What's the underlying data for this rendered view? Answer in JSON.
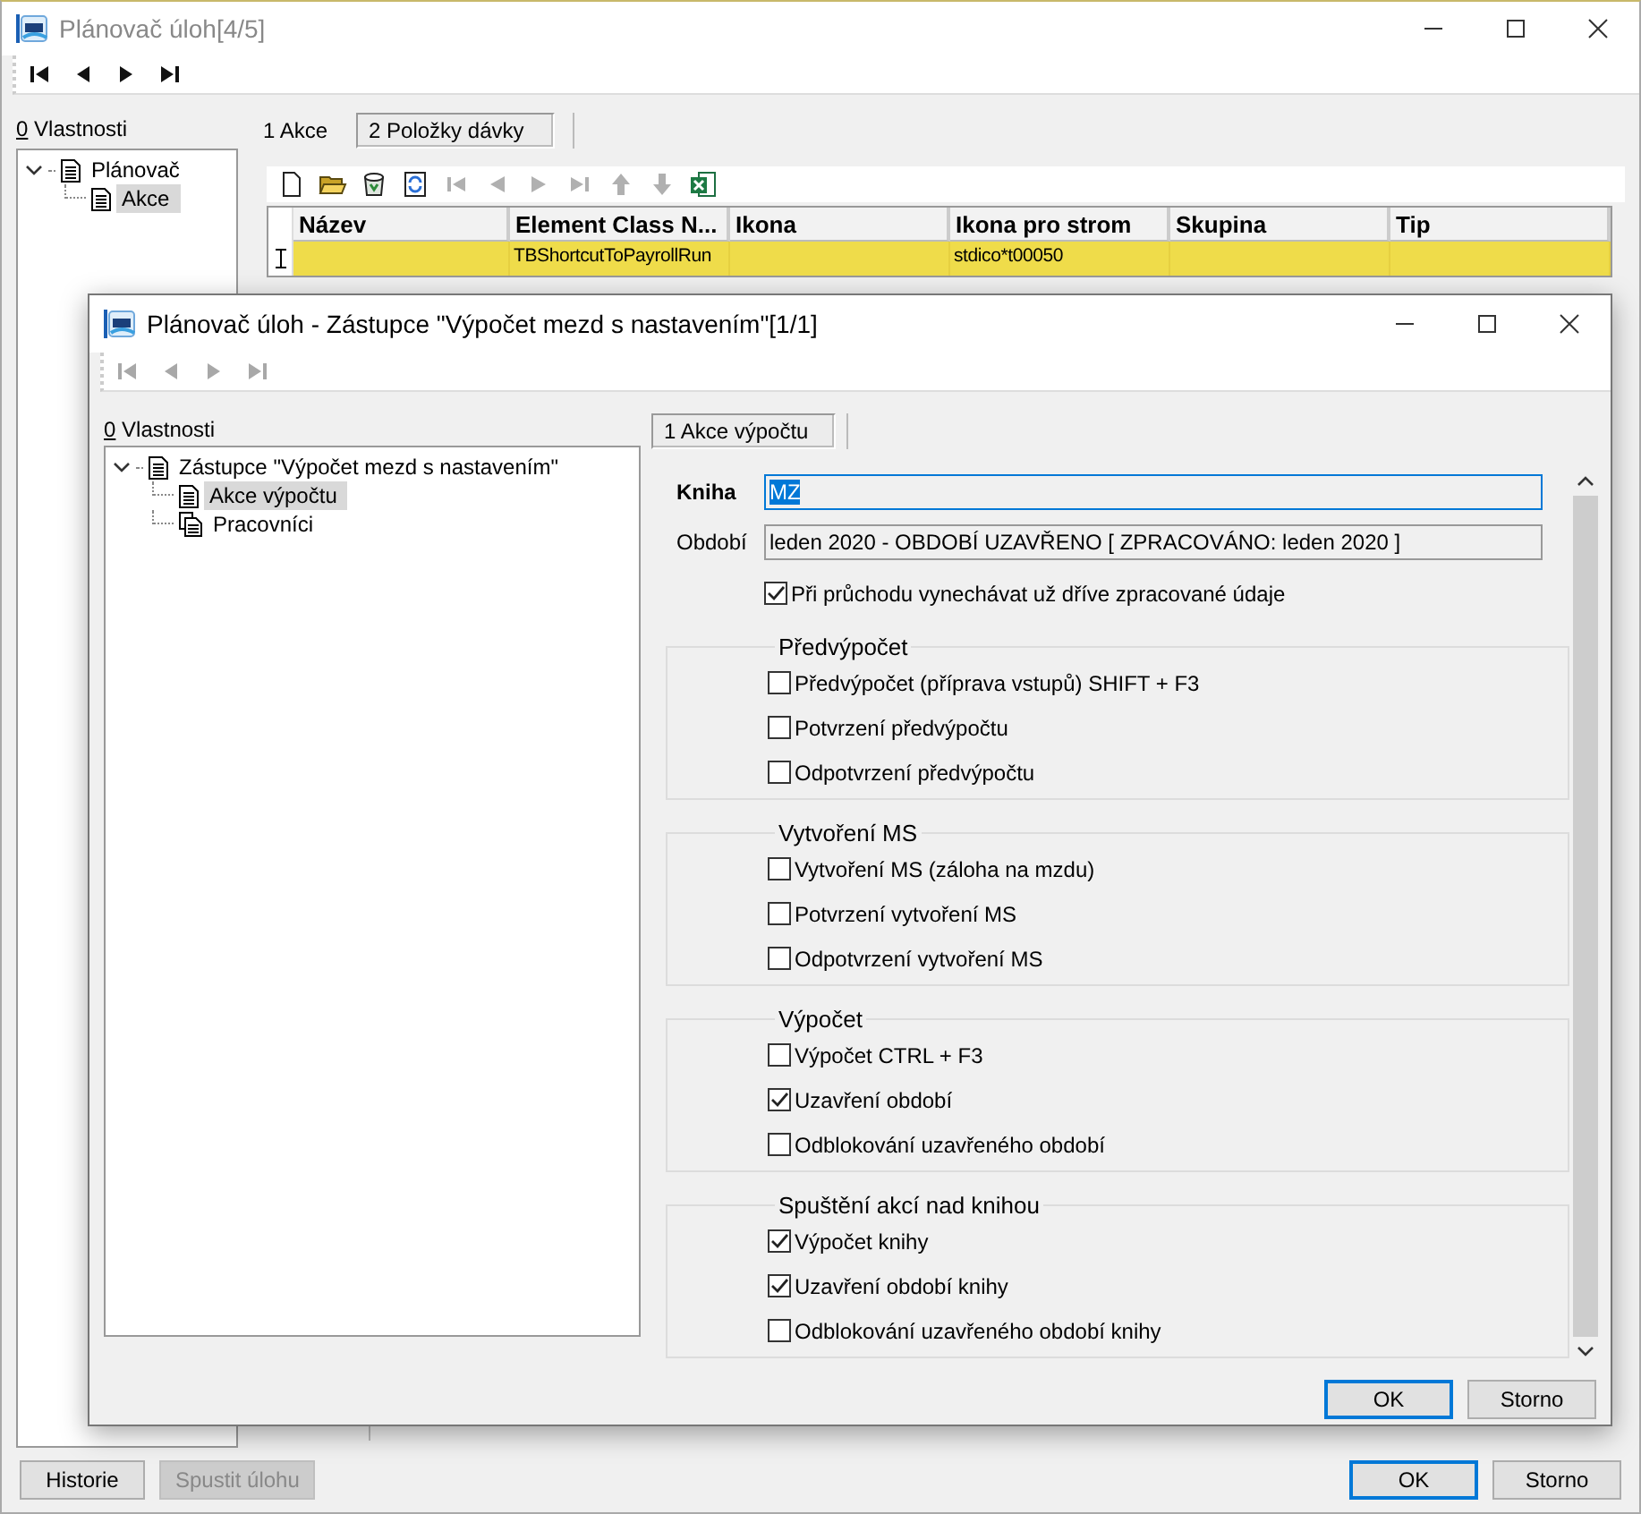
{
  "window": {
    "title": "Plánovač úloh[4/5]",
    "nav_disabled": false
  },
  "properties": {
    "hotkey": "0",
    "label": "Vlastnosti"
  },
  "tree": [
    {
      "label": "Plánovač",
      "kind": "document",
      "expanded": true,
      "selected": false,
      "children": [
        {
          "label": "Akce",
          "kind": "document",
          "selected": true
        }
      ]
    }
  ],
  "tabs": [
    {
      "label": "1 Akce",
      "selected": false
    },
    {
      "label": "2 Položky dávky",
      "selected": true
    }
  ],
  "grid_toolbar": [
    {
      "kind": "new",
      "disabled": false
    },
    {
      "kind": "open",
      "disabled": false
    },
    {
      "kind": "delete",
      "disabled": false
    },
    {
      "kind": "refresh",
      "disabled": false
    },
    {
      "kind": "first",
      "disabled": true
    },
    {
      "kind": "prev",
      "disabled": true
    },
    {
      "kind": "next",
      "disabled": true
    },
    {
      "kind": "last",
      "disabled": true
    },
    {
      "kind": "up",
      "disabled": true
    },
    {
      "kind": "down",
      "disabled": true
    },
    {
      "kind": "excel",
      "disabled": false
    }
  ],
  "table": {
    "columns": [
      "Název",
      "Element Class N...",
      "Ikona",
      "Ikona pro strom",
      "Skupina",
      "Tip"
    ],
    "rows": [
      {
        "selected": true,
        "cells": [
          null,
          "TBShortcutToPayrollRun",
          null,
          "stdico*t00050",
          null,
          null
        ]
      }
    ]
  },
  "left_buttons": [
    {
      "label": "Historie",
      "disabled": false
    },
    {
      "label": "Spustit úlohu",
      "disabled": true
    }
  ],
  "right_buttons": [
    {
      "label": "OK",
      "default": true
    },
    {
      "label": "Storno",
      "default": false
    }
  ],
  "dialog": {
    "title": "Plánovač úloh - Zástupce \"Výpočet mezd s nastavením\"[1/1]",
    "nav_disabled": true,
    "properties": {
      "hotkey": "0",
      "label": "Vlastnosti"
    },
    "tree": [
      {
        "label": "Zástupce \"Výpočet mezd s nastavením\"",
        "kind": "document",
        "expanded": true,
        "selected": false,
        "children": [
          {
            "label": "Akce výpočtu",
            "kind": "document",
            "selected": true
          },
          {
            "label": "Pracovníci",
            "kind": "documents",
            "selected": false
          }
        ]
      }
    ],
    "tabs": [
      {
        "label": "1 Akce výpočtu",
        "selected": true
      }
    ],
    "book": {
      "label": "Kniha",
      "value": "MZ",
      "value_selected": true
    },
    "period": {
      "label": "Období",
      "value": "leden 2020 - OBDOBÍ UZAVŘENO [ ZPRACOVÁNO: leden 2020 ]"
    },
    "skip_processed": {
      "label": "Při průchodu vynechávat už dříve zpracované údaje",
      "checked": true
    },
    "groups": [
      {
        "title": "Předvýpočet",
        "items": [
          {
            "label": "Předvýpočet (příprava vstupů) SHIFT + F3",
            "checked": false
          },
          {
            "label": "Potvrzení předvýpočtu",
            "checked": false
          },
          {
            "label": "Odpotvrzení předvýpočtu",
            "checked": false
          }
        ]
      },
      {
        "title": "Vytvoření MS",
        "items": [
          {
            "label": "Vytvoření MS (záloha na mzdu)",
            "checked": false
          },
          {
            "label": "Potvrzení vytvoření MS",
            "checked": false
          },
          {
            "label": "Odpotvrzení vytvoření MS",
            "checked": false
          }
        ]
      },
      {
        "title": "Výpočet",
        "items": [
          {
            "label": "Výpočet CTRL + F3",
            "checked": false
          },
          {
            "label": "Uzavření období",
            "checked": true
          },
          {
            "label": "Odblokování uzavřeného období",
            "checked": false
          }
        ]
      },
      {
        "title": "Spuštění akcí nad knihou",
        "items": [
          {
            "label": "Výpočet knihy",
            "checked": true
          },
          {
            "label": "Uzavření období knihy",
            "checked": true
          },
          {
            "label": "Odblokování uzavřeného období knihy",
            "checked": false
          }
        ]
      }
    ],
    "buttons": [
      {
        "label": "OK",
        "default": true
      },
      {
        "label": "Storno",
        "default": false
      }
    ]
  }
}
